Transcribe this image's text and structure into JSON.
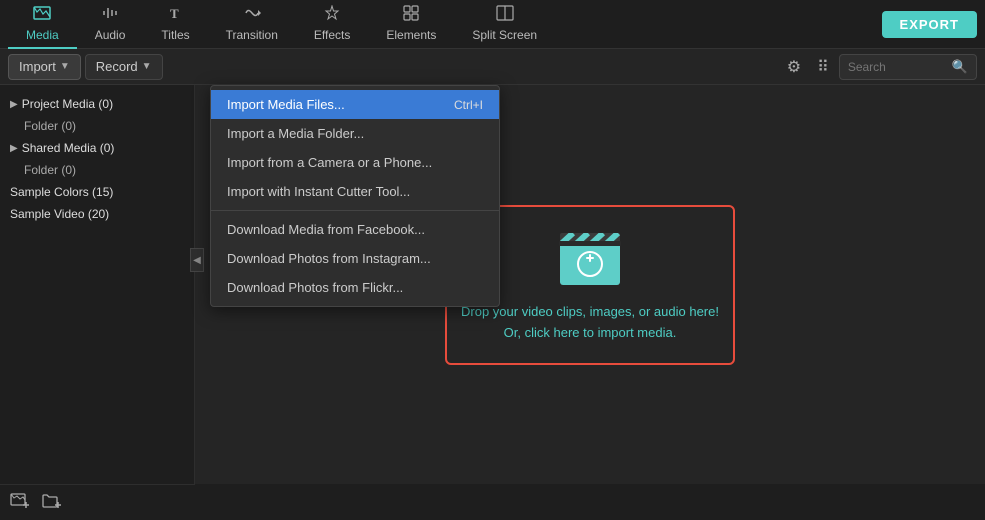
{
  "topNav": {
    "items": [
      {
        "id": "media",
        "label": "Media",
        "icon": "🗂",
        "active": true
      },
      {
        "id": "audio",
        "label": "Audio",
        "icon": "♪"
      },
      {
        "id": "titles",
        "label": "Titles",
        "icon": "T"
      },
      {
        "id": "transition",
        "label": "Transition",
        "icon": "⇄"
      },
      {
        "id": "effects",
        "label": "Effects",
        "icon": "✦"
      },
      {
        "id": "elements",
        "label": "Elements",
        "icon": "▦"
      },
      {
        "id": "splitscreen",
        "label": "Split Screen",
        "icon": "⊟"
      }
    ],
    "exportLabel": "EXPORT"
  },
  "secondBar": {
    "importLabel": "Import",
    "recordLabel": "Record",
    "searchPlaceholder": "Search"
  },
  "sidebar": {
    "items": [
      {
        "id": "project-media",
        "label": "Project Media (0)",
        "level": "parent",
        "hasArrow": true
      },
      {
        "id": "folder-0",
        "label": "Folder (0)",
        "level": "child"
      },
      {
        "id": "shared-media",
        "label": "Shared Media (0)",
        "level": "parent",
        "hasArrow": true
      },
      {
        "id": "folder-1",
        "label": "Folder (0)",
        "level": "child"
      },
      {
        "id": "sample-colors",
        "label": "Sample Colors (15)",
        "level": "parent"
      },
      {
        "id": "sample-video",
        "label": "Sample Video (20)",
        "level": "parent"
      }
    ],
    "bottomIcons": [
      {
        "id": "add-media",
        "icon": "📁+"
      },
      {
        "id": "add-folder",
        "icon": "📂+"
      }
    ]
  },
  "dropZone": {
    "line1": "Drop your video clips, images, or audio here!",
    "line2": "Or, click here to import media."
  },
  "dropdownMenu": {
    "items": [
      {
        "id": "import-files",
        "label": "Import Media Files...",
        "shortcut": "Ctrl+I",
        "highlighted": true
      },
      {
        "id": "import-folder",
        "label": "Import a Media Folder..."
      },
      {
        "id": "import-camera",
        "label": "Import from a Camera or a Phone..."
      },
      {
        "id": "import-cutter",
        "label": "Import with Instant Cutter Tool..."
      },
      {
        "id": "divider1",
        "type": "divider"
      },
      {
        "id": "download-facebook",
        "label": "Download Media from Facebook..."
      },
      {
        "id": "download-instagram",
        "label": "Download Photos from Instagram..."
      },
      {
        "id": "download-flickr",
        "label": "Download Photos from Flickr..."
      }
    ]
  }
}
